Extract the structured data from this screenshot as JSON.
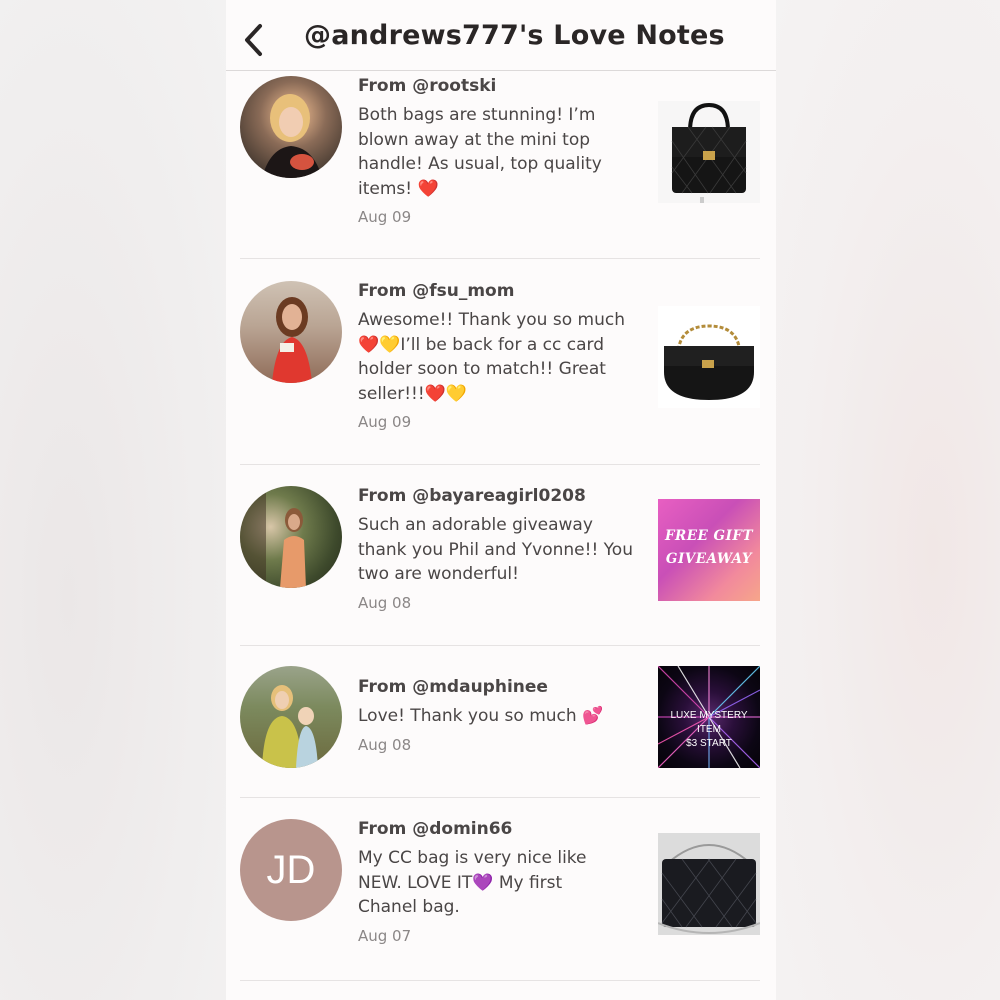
{
  "header": {
    "title": "@andrews777's Love Notes",
    "back_icon": "chevron-left-icon"
  },
  "notes": [
    {
      "from": "From @rootski",
      "lines": [
        "Both bags are stunning! I’m",
        "blown away at the mini top",
        "handle! As usual, top quality",
        "items! ❤️"
      ],
      "date": "Aug 09",
      "thumb": "black-quilted-flap-bag"
    },
    {
      "from": "From @fsu_mom",
      "lines": [
        "Awesome!! Thank you so much",
        "❤️💛I’ll be back for a cc card",
        "holder soon to match!! Great",
        "seller!!!❤️💛"
      ],
      "date": "Aug 09",
      "thumb": "black-chain-crossbody-bag"
    },
    {
      "from": "From @bayareagirl0208",
      "lines": [
        "Such an adorable giveaway",
        "thank you Phil and Yvonne!! You",
        "two are wonderful!"
      ],
      "date": "Aug 08",
      "thumb_text": [
        "FREE GIFT",
        "GIVEAWAY"
      ]
    },
    {
      "from": "From @mdauphinee",
      "lines": [
        "Love! Thank you so much 💕"
      ],
      "date": "Aug 08",
      "thumb_text": [
        "LUXE MYSTERY ITEM",
        "$3 START"
      ]
    },
    {
      "from": "From @domin66",
      "lines": [
        "My CC bag is very nice like",
        "NEW. LOVE IT💜 My first",
        "Chanel bag."
      ],
      "date": "Aug 07",
      "avatar_initials": "JD",
      "thumb": "black-quilted-chain-bag"
    }
  ],
  "colors": {
    "text": "#4a4646",
    "date": "#8b8787",
    "initials_avatar": "#b8958d"
  }
}
